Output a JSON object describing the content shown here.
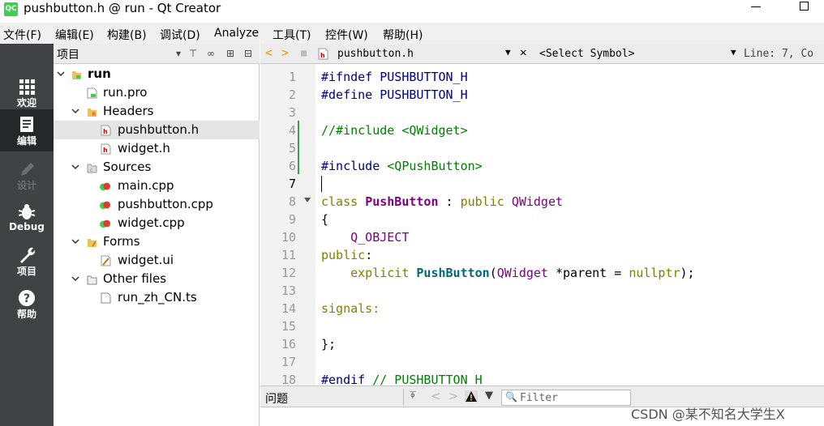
{
  "window": {
    "title": "pushbutton.h @ run - Qt Creator",
    "logo_text": "QC"
  },
  "menu": [
    "文件(F)",
    "编辑(E)",
    "构建(B)",
    "调试(D)",
    "Analyze",
    "工具(T)",
    "控件(W)",
    "帮助(H)"
  ],
  "modes": [
    {
      "label": "欢迎",
      "icon": "grid-icon"
    },
    {
      "label": "编辑",
      "icon": "document-icon"
    },
    {
      "label": "设计",
      "icon": "pencil-icon"
    },
    {
      "label": "Debug",
      "icon": "bug-icon"
    },
    {
      "label": "项目",
      "icon": "wrench-icon"
    },
    {
      "label": "帮助",
      "icon": "help-icon"
    }
  ],
  "navigator": {
    "title": "项目",
    "tree": [
      {
        "label": "run",
        "bold": true
      },
      {
        "label": "run.pro"
      },
      {
        "label": "Headers"
      },
      {
        "label": "pushbutton.h",
        "selected": true
      },
      {
        "label": "widget.h"
      },
      {
        "label": "Sources"
      },
      {
        "label": "main.cpp"
      },
      {
        "label": "pushbutton.cpp"
      },
      {
        "label": "widget.cpp"
      },
      {
        "label": "Forms"
      },
      {
        "label": "widget.ui"
      },
      {
        "label": "Other files"
      },
      {
        "label": "run_zh_CN.ts"
      }
    ]
  },
  "editor": {
    "file": "pushbutton.h",
    "symbol": "<Select Symbol>",
    "position": "Line: 7, Co",
    "current_line": 7,
    "lines": [
      "1",
      "2",
      "3",
      "4",
      "5",
      "6",
      "7",
      "8",
      "9",
      "10",
      "11",
      "12",
      "13",
      "14",
      "15",
      "16",
      "17",
      "18"
    ],
    "code": {
      "l1": "#ifndef PUSHBUTTON_H",
      "l2": "#define PUSHBUTTON_H",
      "l4": "//#include <QWidget>",
      "l6a": "#include ",
      "l6b": "<QPushButton>",
      "l8a": "class ",
      "l8b": "PushButton",
      "l8c": " : ",
      "l8d": "public",
      "l8e": " ",
      "l8f": "QWidget",
      "l9": "{",
      "l10": "    Q_OBJECT",
      "l11a": "public",
      "l11b": ":",
      "l12a": "    explicit ",
      "l12b": "PushButton",
      "l12c": "(",
      "l12d": "QWidget",
      "l12e": " *parent = ",
      "l12f": "nullptr",
      "l12g": ");",
      "l14": "signals:",
      "l16": "};",
      "l18a": "#endif ",
      "l18b": "// PUSHBUTTON_H"
    }
  },
  "bottom_panel": {
    "title": "问题",
    "filter_placeholder": "Filter"
  },
  "watermark": "CSDN @某不知名大学生X",
  "colors": {
    "modebar": "#404244",
    "mode_active": "#262728",
    "keyword": "#808000",
    "type": "#800080",
    "preproc": "#000080",
    "comment": "#008000"
  }
}
